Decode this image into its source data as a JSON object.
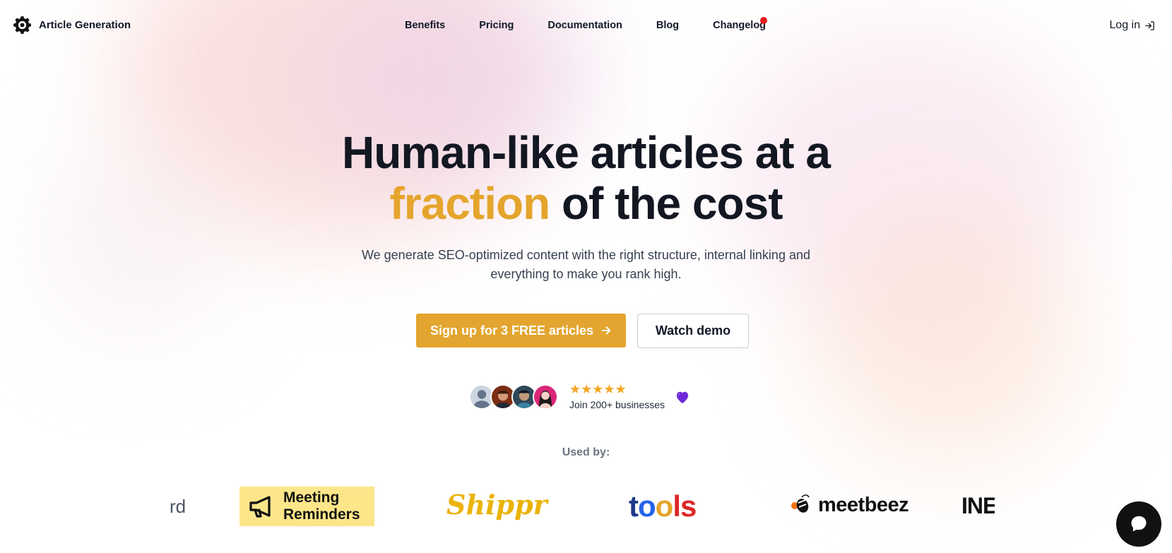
{
  "brand": {
    "name": "Article Generation",
    "logo_icon": "gear-icon"
  },
  "nav": {
    "items": [
      {
        "label": "Benefits"
      },
      {
        "label": "Pricing"
      },
      {
        "label": "Documentation"
      },
      {
        "label": "Blog"
      },
      {
        "label": "Changelog",
        "notification_dot": true
      }
    ]
  },
  "header": {
    "login_label": "Log in",
    "login_icon": "log-in-icon"
  },
  "hero": {
    "title_line1": "Human-like articles at a",
    "title_accent": "fraction",
    "title_line2_rest": " of the cost",
    "subtitle": "We generate SEO-optimized content with the right structure, internal linking and everything to make you rank high.",
    "accent_color": "#e5a52d"
  },
  "cta": {
    "primary_label": "Sign up for 3 FREE articles",
    "primary_icon": "arrow-right-icon",
    "secondary_label": "Watch demo"
  },
  "social_proof": {
    "rating": 5,
    "stars": "★★★★★",
    "join_text": "Join 200+ businesses",
    "heart_icon": "purple-heart-icon",
    "avatar_count": 4
  },
  "used_by": {
    "label": "Used by:",
    "logos": {
      "partial_left": "rd",
      "meeting_reminders": "Meeting Reminders",
      "meeting_line1": "Meeting",
      "meeting_line2": "Reminders",
      "shippr": "Shippr",
      "tools": [
        "t",
        "o",
        "o",
        "l",
        "s"
      ],
      "meetbeez": "meetbeez",
      "partial_right": "INE"
    }
  },
  "chat_widget": {
    "icon": "chat-bubble-icon"
  }
}
